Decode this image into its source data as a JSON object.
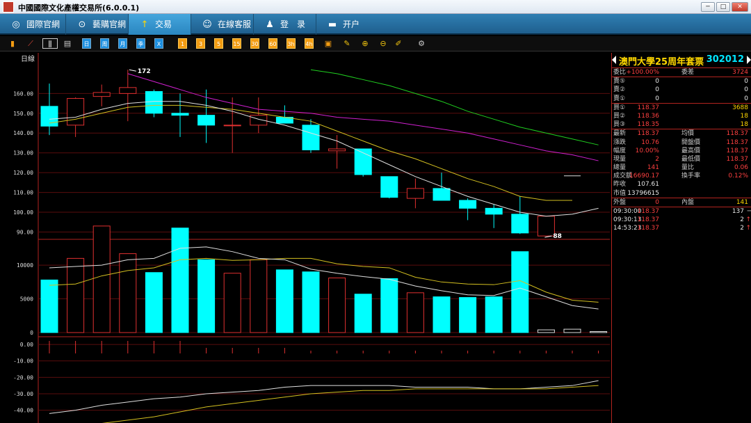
{
  "window": {
    "title": "中國國際文化產權交易所(6.0.0.1)",
    "min": "─",
    "max": "□",
    "close": "✕"
  },
  "nav": [
    {
      "label": "國際官網",
      "icon": "◎"
    },
    {
      "label": "藝購官網",
      "icon": "⊙"
    },
    {
      "label": "交易",
      "icon": "↑"
    },
    {
      "label": "在線客服",
      "icon": "☺"
    },
    {
      "label": "登　录",
      "icon": "♟"
    },
    {
      "label": "开户",
      "icon": "▬"
    }
  ],
  "toolbar": {
    "periods": [
      "日",
      "周",
      "月",
      "季",
      "X"
    ],
    "minutes": [
      "1",
      "3",
      "5",
      "15",
      "30",
      "60",
      "3h",
      "4h"
    ]
  },
  "chart_data": {
    "type": "candlestick",
    "label": "日線",
    "price_axis": {
      "ticks": [
        "160.00",
        "150.00",
        "140.00",
        "130.00",
        "120.00",
        "110.00",
        "100.00",
        "90.00"
      ],
      "min": 87,
      "max": 177
    },
    "hi_label": "172",
    "lo_label": "88",
    "candles": [
      {
        "o": 153.5,
        "h": 165,
        "l": 139,
        "c": 143.5
      },
      {
        "o": 144,
        "h": 158,
        "l": 138,
        "c": 157.5
      },
      {
        "o": 158.5,
        "h": 164.5,
        "l": 153.5,
        "c": 160.5
      },
      {
        "o": 160,
        "h": 172,
        "l": 146,
        "c": 163
      },
      {
        "o": 161,
        "h": 162,
        "l": 148,
        "c": 150
      },
      {
        "o": 150,
        "h": 160,
        "l": 138,
        "c": 149
      },
      {
        "o": 149,
        "h": 162,
        "l": 135,
        "c": 144
      },
      {
        "o": 144,
        "h": 158,
        "l": 130,
        "c": 144
      },
      {
        "o": 144,
        "h": 158,
        "l": 140,
        "c": 149
      },
      {
        "o": 148,
        "h": 154,
        "l": 145,
        "c": 145
      },
      {
        "o": 144,
        "h": 147,
        "l": 130,
        "c": 131.5
      },
      {
        "o": 131,
        "h": 139,
        "l": 122,
        "c": 132
      },
      {
        "o": 132,
        "h": 132,
        "l": 118,
        "c": 119
      },
      {
        "o": 118,
        "h": 118,
        "l": 107,
        "c": 107.5
      },
      {
        "o": 107,
        "h": 117,
        "l": 102,
        "c": 112
      },
      {
        "o": 112,
        "h": 120,
        "l": 106,
        "c": 106
      },
      {
        "o": 106,
        "h": 107,
        "l": 96,
        "c": 102
      },
      {
        "o": 102,
        "h": 104,
        "l": 92,
        "c": 99
      },
      {
        "o": 99,
        "h": 108,
        "l": 89,
        "c": 89.5
      },
      {
        "o": 88,
        "h": 98,
        "l": 88,
        "c": 98
      },
      {
        "o": 118.37,
        "h": 118.37,
        "l": 118.37,
        "c": 118.37
      }
    ],
    "ma_white": [
      147,
      148,
      152,
      155,
      156,
      156,
      154,
      151,
      147,
      144,
      140,
      136,
      130,
      124,
      118,
      113,
      108,
      104,
      100,
      98,
      99,
      102
    ],
    "ma_yellow": [
      145,
      147,
      150,
      153,
      154,
      154,
      153,
      152,
      150,
      148,
      146,
      141,
      136,
      131,
      127,
      122,
      117,
      113,
      108,
      106,
      106
    ],
    "ma_magenta": [
      null,
      null,
      null,
      170,
      166,
      162,
      158,
      155,
      152,
      151,
      150,
      148,
      147,
      146,
      144,
      142,
      140,
      137,
      134,
      131,
      129,
      126
    ],
    "ma_green": [
      null,
      null,
      null,
      null,
      null,
      null,
      null,
      null,
      null,
      null,
      172,
      170,
      167,
      164,
      160,
      156,
      151,
      147,
      143,
      140,
      137,
      134
    ],
    "vol_axis": {
      "ticks": [
        "10000",
        "5000",
        "0"
      ],
      "max": 13000
    },
    "volume": [
      7800,
      11000,
      15800,
      11700,
      8900,
      15500,
      10800,
      8800,
      10800,
      9300,
      9000,
      8100,
      5700,
      8000,
      5900,
      5300,
      5200,
      5300,
      12000,
      400,
      500,
      150
    ],
    "vol_ma_white": [
      9600,
      9800,
      10000,
      10800,
      11000,
      12500,
      12700,
      12000,
      11000,
      10800,
      9400,
      8800,
      8300,
      7900,
      6900,
      6200,
      5600,
      5500,
      6600,
      5300,
      4000,
      3500
    ],
    "vol_ma_yellow": [
      7000,
      7200,
      8400,
      9200,
      9600,
      10800,
      11000,
      10700,
      10800,
      11000,
      11000,
      10200,
      9800,
      9600,
      8200,
      7500,
      7200,
      7100,
      7700,
      6000,
      4800,
      4500
    ],
    "ind_axis": {
      "ticks": [
        "0.00",
        "-10.00",
        "-20.00",
        "-30.00",
        "-40.00",
        "-50.00"
      ],
      "min": -52,
      "max": 3
    },
    "ind_white": [
      -42,
      -40,
      -37,
      -35,
      -33,
      -32,
      -30,
      -29,
      -28,
      -26,
      -25,
      -25,
      -25,
      -25,
      -26,
      -26,
      -26,
      -27,
      -27,
      -26,
      -25,
      -22
    ],
    "ind_yellow": [
      -52,
      -50,
      -48,
      -46,
      -44,
      -41,
      -38,
      -36,
      -34,
      -32,
      -30,
      -29,
      -28,
      -28,
      -27,
      -27,
      -27,
      -27,
      -27,
      -27,
      -26,
      -25
    ]
  },
  "side": {
    "name": "澳門大學25周年套票",
    "code": "302012",
    "rows1": [
      [
        "委比",
        "+100.00%",
        "委差",
        "3724"
      ]
    ],
    "asks": [
      [
        "賣⑤",
        "0",
        "0"
      ],
      [
        "賣②",
        "0",
        "0"
      ],
      [
        "賣①",
        "0",
        "0"
      ]
    ],
    "bids": [
      [
        "買①",
        "118.37",
        "3688"
      ],
      [
        "買②",
        "118.36",
        "18"
      ],
      [
        "買③",
        "118.35",
        "18"
      ]
    ],
    "stats": [
      [
        "最新",
        "118.37",
        "均價",
        "118.37"
      ],
      [
        "漲跌",
        "10.76",
        "開盤價",
        "118.37"
      ],
      [
        "幅度",
        "10.00%",
        "最高價",
        "118.37"
      ],
      [
        "現量",
        "2",
        "最低價",
        "118.37"
      ],
      [
        "總量",
        "141",
        "量比",
        "0.06"
      ],
      [
        "成交額",
        "16690.17",
        "換手率",
        "0.12%"
      ],
      [
        "昨收",
        "107.61",
        "",
        ""
      ],
      [
        "市值",
        "13796615",
        "",
        ""
      ]
    ],
    "outin": [
      "外盤",
      "0",
      "內盤",
      "141"
    ],
    "ticks": [
      [
        "09:30:00",
        "118.37",
        "137",
        "─"
      ],
      [
        "09:30:13",
        "118.37",
        "2",
        "↑"
      ],
      [
        "14:53:23",
        "118.37",
        "2",
        "↑"
      ]
    ]
  }
}
